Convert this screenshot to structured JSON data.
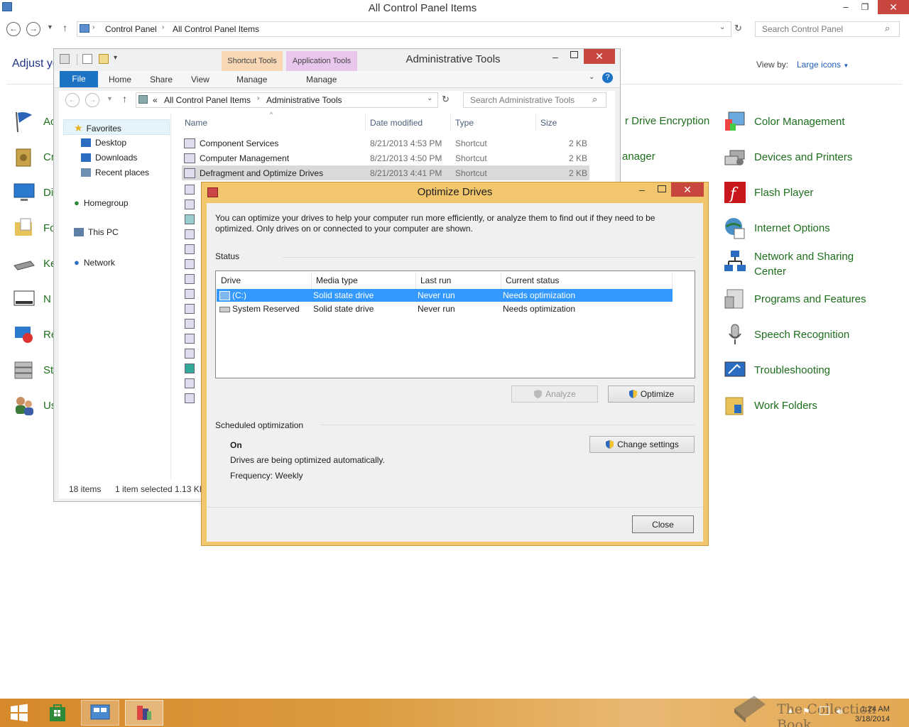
{
  "control_panel": {
    "title": "All Control Panel Items",
    "minimize": "–",
    "restore": "❐",
    "close": "✕",
    "breadcrumbs": [
      "Control Panel",
      "All Control Panel Items"
    ],
    "search_placeholder": "Search Control Panel",
    "heading_partial": "Adjust yo",
    "view_by_label": "View by:",
    "view_mode": "Large icons",
    "left_items_partial": [
      "Ac",
      "Cr",
      "Di",
      "Fo",
      "Ke",
      "N",
      "Re",
      "St",
      "Us"
    ],
    "middle_items_partial": [
      "r Drive Encryption",
      "anager"
    ],
    "right_items": [
      {
        "label": "Color Management",
        "icon": "color-management-icon"
      },
      {
        "label": "Devices and Printers",
        "icon": "devices-printers-icon"
      },
      {
        "label": "Flash Player",
        "icon": "flash-player-icon"
      },
      {
        "label": "Internet Options",
        "icon": "internet-options-icon"
      },
      {
        "label": "Network and Sharing Center",
        "icon": "network-sharing-icon"
      },
      {
        "label": "Programs and Features",
        "icon": "programs-features-icon"
      },
      {
        "label": "Speech Recognition",
        "icon": "microphone-icon"
      },
      {
        "label": "Troubleshooting",
        "icon": "troubleshooting-icon"
      },
      {
        "label": "Work Folders",
        "icon": "work-folders-icon"
      }
    ]
  },
  "admin_tools": {
    "title": "Administrative Tools",
    "context_shortcut": "Shortcut Tools",
    "context_app": "Application Tools",
    "ribbon_tabs": [
      "File",
      "Home",
      "Share",
      "View",
      "Manage",
      "Manage"
    ],
    "address": [
      "«",
      "All Control Panel Items",
      "Administrative Tools"
    ],
    "search_placeholder": "Search Administrative Tools",
    "nav": {
      "favorites": "Favorites",
      "desktop": "Desktop",
      "downloads": "Downloads",
      "recent": "Recent places",
      "homegroup": "Homegroup",
      "thispc": "This PC",
      "network": "Network"
    },
    "columns": {
      "name": "Name",
      "date": "Date modified",
      "type": "Type",
      "size": "Size"
    },
    "files": [
      {
        "name": "Component Services",
        "date": "8/21/2013 4:53 PM",
        "type": "Shortcut",
        "size": "2 KB"
      },
      {
        "name": "Computer Management",
        "date": "8/21/2013 4:50 PM",
        "type": "Shortcut",
        "size": "2 KB"
      },
      {
        "name": "Defragment and Optimize Drives",
        "date": "8/21/2013 4:41 PM",
        "type": "Shortcut",
        "size": "2 KB"
      }
    ],
    "status_count": "18 items",
    "status_selected": "1 item selected  1.13 KB"
  },
  "optimize_drives": {
    "title": "Optimize Drives",
    "intro": "You can optimize your drives to help your computer run more efficiently, or analyze them to find out if they need to be optimized. Only drives on or connected to your computer are shown.",
    "status_label": "Status",
    "columns": {
      "drive": "Drive",
      "media": "Media type",
      "last_run": "Last run",
      "status": "Current status"
    },
    "drives": [
      {
        "drive": "(C:)",
        "media": "Solid state drive",
        "last_run": "Never run",
        "status": "Needs optimization",
        "selected": true
      },
      {
        "drive": "System Reserved",
        "media": "Solid state drive",
        "last_run": "Never run",
        "status": "Needs optimization",
        "selected": false
      }
    ],
    "analyze_label": "Analyze",
    "optimize_label": "Optimize",
    "scheduled_label": "Scheduled optimization",
    "sched_state": "On",
    "sched_desc": "Drives are being optimized automatically.",
    "sched_freq": "Frequency: Weekly",
    "change_settings_label": "Change settings",
    "close_label": "Close"
  },
  "taskbar": {
    "time": "1:24 AM",
    "date": "3/18/2014",
    "watermark": "The Collection Book"
  },
  "colors": {
    "cp_link_green": "#1e6e1e",
    "selection_blue": "#3399ff",
    "close_red": "#c7463e",
    "dialog_frame": "#f2c66c"
  }
}
